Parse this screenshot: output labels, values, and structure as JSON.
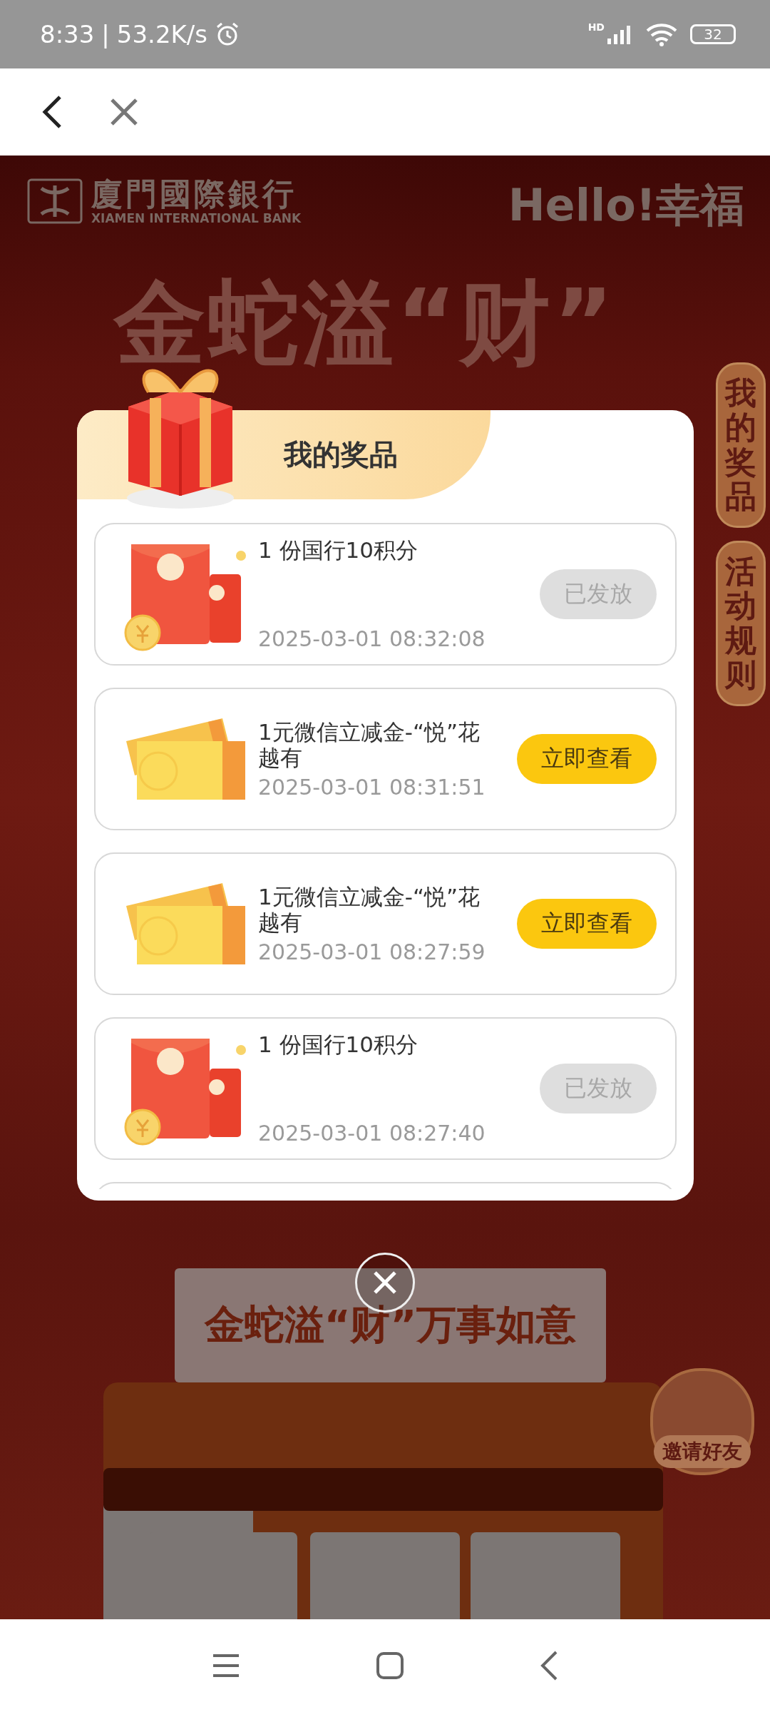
{
  "status_bar": {
    "time": "8:33",
    "separator": "|",
    "speed": "53.2K/s",
    "network": "HD",
    "battery": "32"
  },
  "background": {
    "bank_name": "廈門國際銀行",
    "bank_name_en": "XIAMEN INTERNATIONAL BANK",
    "brand": "Hello!幸福",
    "title": "金蛇溢“财”",
    "side_tabs": [
      "我的奖品",
      "活动规则"
    ],
    "banner": "金蛇溢“财”万事如意",
    "invite": "邀请好友"
  },
  "modal": {
    "title": "我的奖品",
    "prizes": [
      {
        "kind": "red_packet",
        "name": "1 份国行10积分",
        "time": "2025-03-01 08:32:08",
        "action": "已发放",
        "disabled": true
      },
      {
        "kind": "coupon",
        "name": "1元微信立减金-“悦”花越有",
        "time": "2025-03-01 08:31:51",
        "action": "立即查看",
        "disabled": false
      },
      {
        "kind": "coupon",
        "name": "1元微信立减金-“悦”花越有",
        "time": "2025-03-01 08:27:59",
        "action": "立即查看",
        "disabled": false
      },
      {
        "kind": "red_packet",
        "name": "1 份国行10积分",
        "time": "2025-03-01 08:27:40",
        "action": "已发放",
        "disabled": true
      }
    ]
  }
}
